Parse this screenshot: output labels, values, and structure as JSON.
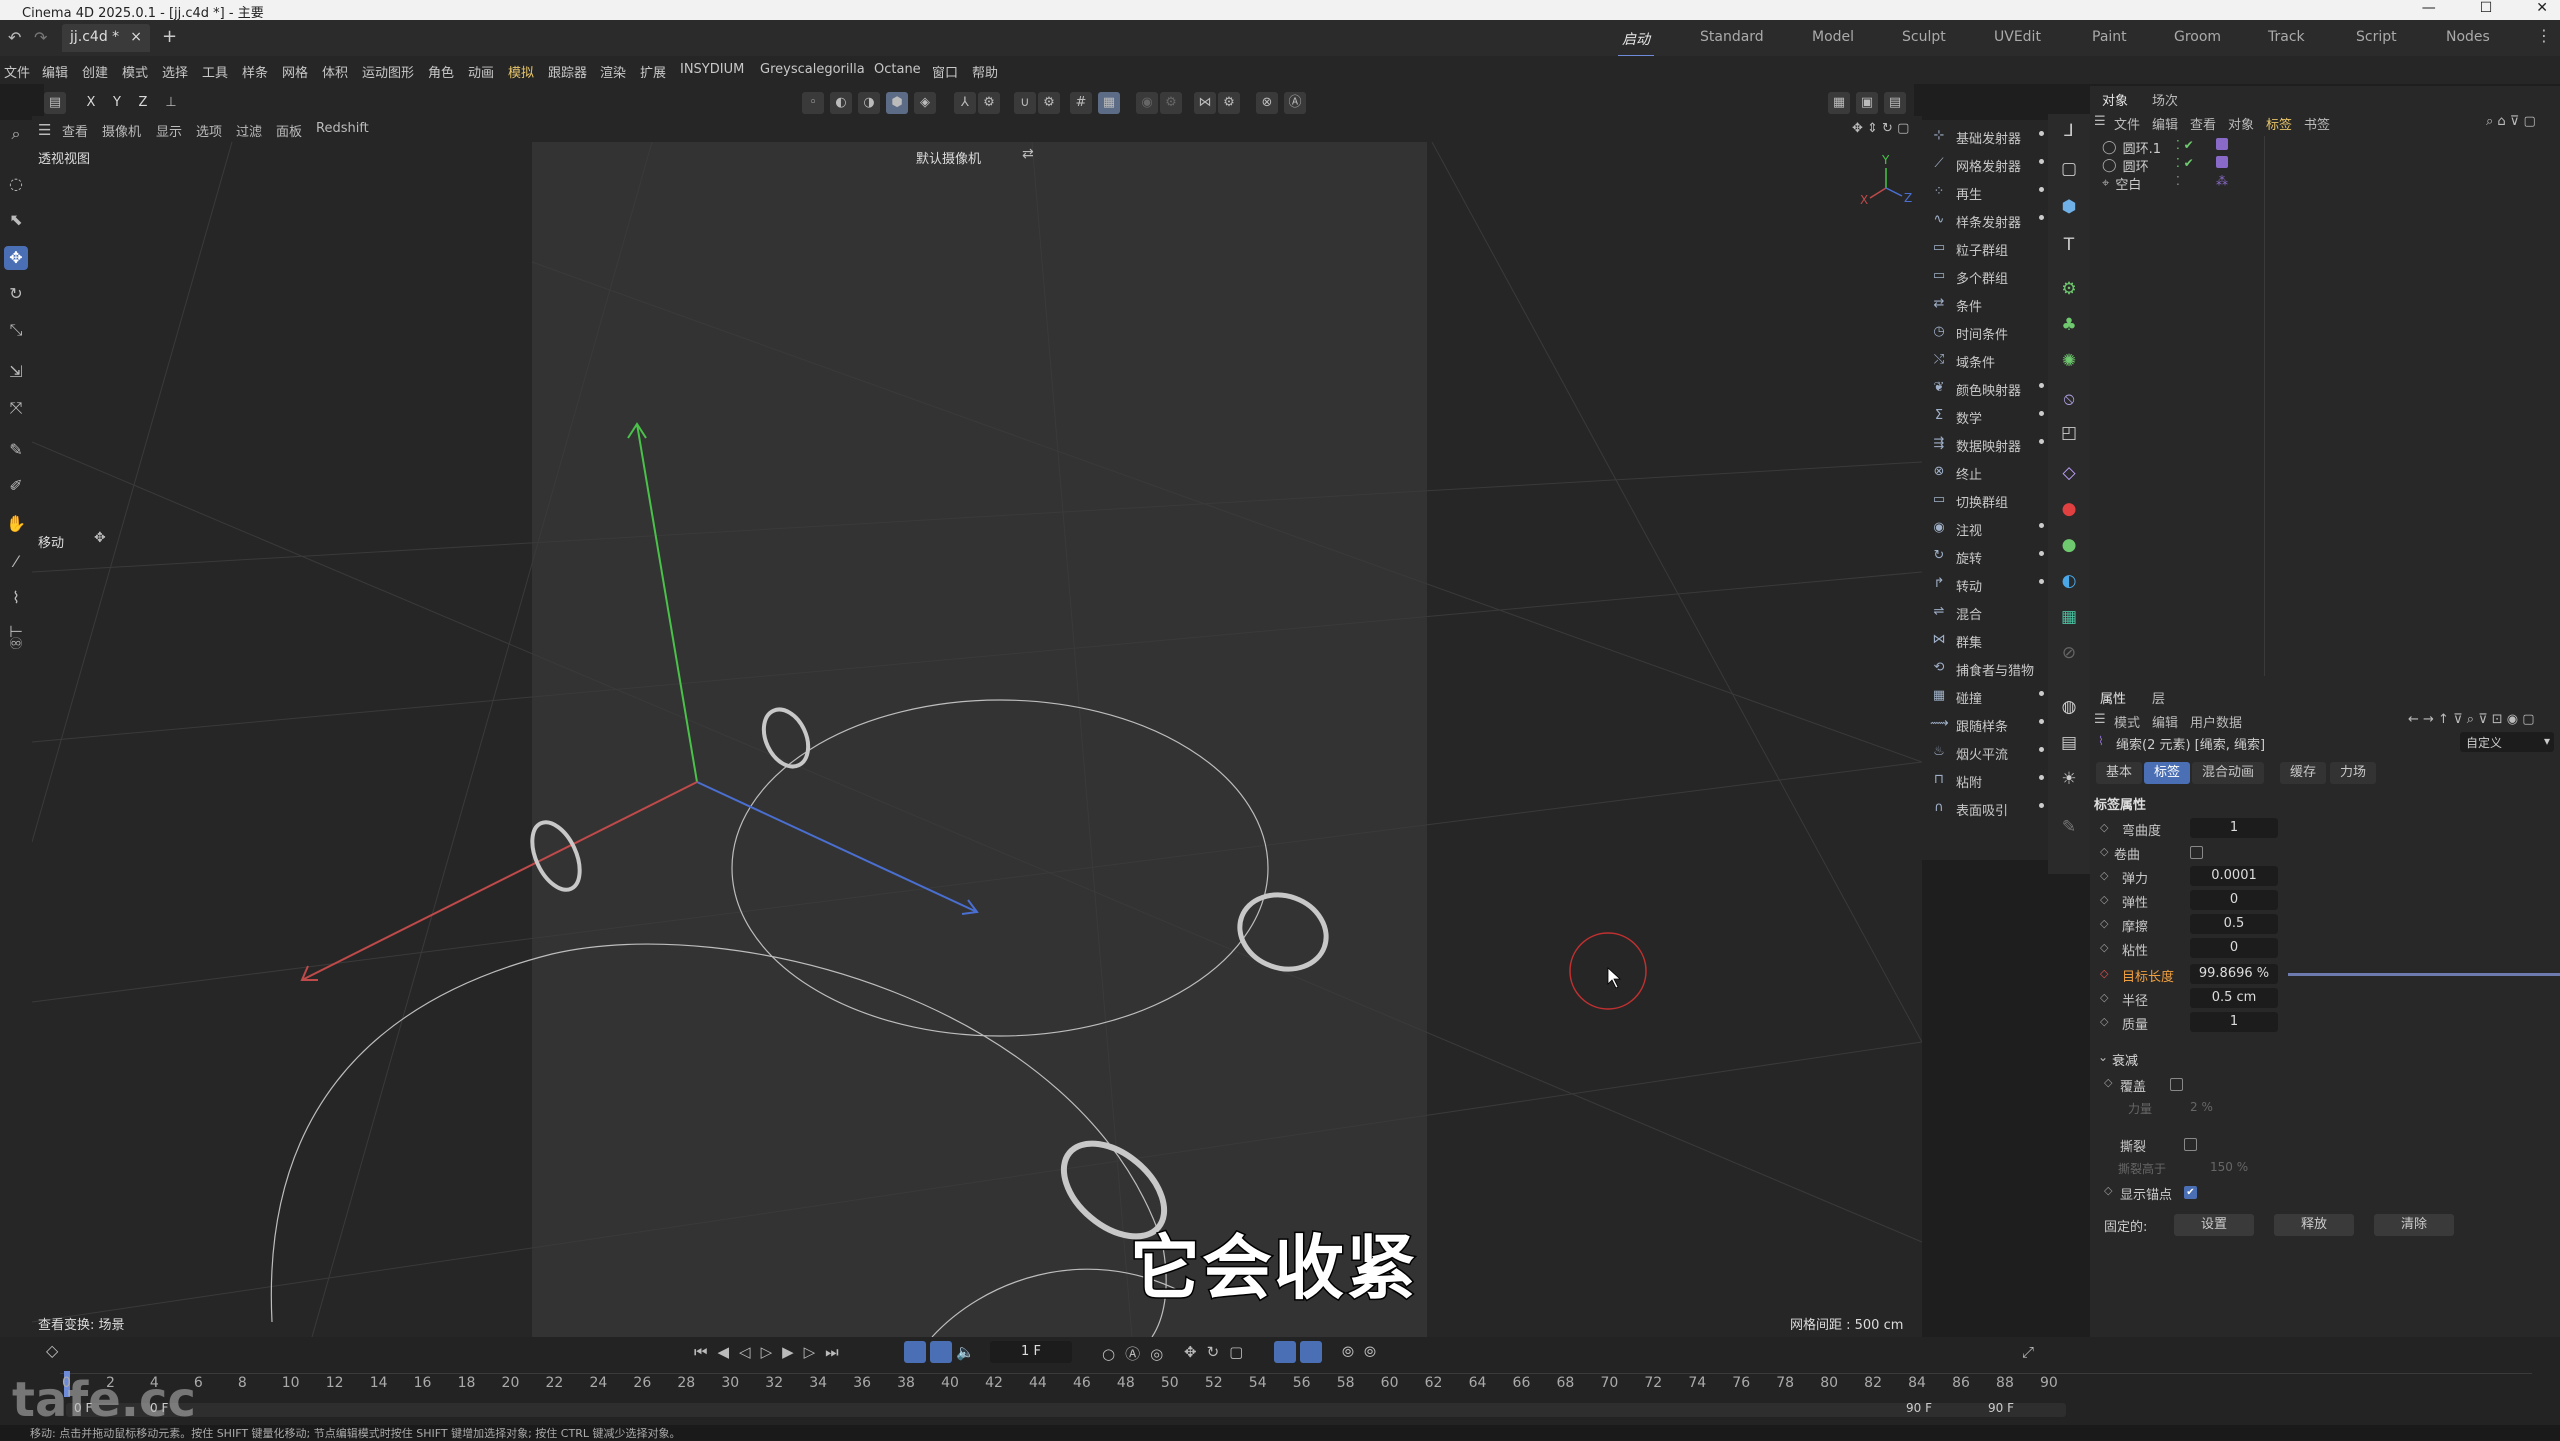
{
  "window": {
    "title": "Cinema 4D 2025.0.1 - [jj.c4d *] - 主要",
    "controls": [
      "—",
      "☐",
      "✕"
    ]
  },
  "document_tab": {
    "label": "jj.c4d *",
    "close": "×",
    "add": "+"
  },
  "layouts": [
    "启动",
    "Standard",
    "Model",
    "Sculpt",
    "UVEdit",
    "Paint",
    "Groom",
    "Track",
    "Script",
    "Nodes"
  ],
  "menu": [
    "文件",
    "编辑",
    "创建",
    "模式",
    "选择",
    "工具",
    "样条",
    "网格",
    "体积",
    "运动图形",
    "角色",
    "动画",
    "模拟",
    "跟踪器",
    "渲染",
    "扩展",
    "INSYDIUM",
    "Greyscalegorilla",
    "Octane",
    "窗口",
    "帮助"
  ],
  "axis_lock": [
    "X",
    "Y",
    "Z"
  ],
  "viewport_menu": [
    "查看",
    "摄像机",
    "显示",
    "选项",
    "过滤",
    "面板",
    "Redshift"
  ],
  "viewport": {
    "name": "透视视图",
    "camera": "默认摄像机",
    "tool": "移动",
    "status_left": "查看变换: 场景",
    "grid_spacing": "网格间距 : 500 cm"
  },
  "fx_menu": [
    "基础发射器",
    "网格发射器",
    "再生",
    "样条发射器",
    "粒子群组",
    "多个群组",
    "条件",
    "时间条件",
    "域条件",
    "颜色映射器",
    "数学",
    "数据映射器",
    "终止",
    "切换群组",
    "注视",
    "旋转",
    "转动",
    "混合",
    "群集",
    "捕食者与猎物",
    "碰撞",
    "跟随样条",
    "烟火平流",
    "粘附",
    "表面吸引"
  ],
  "object_panel": {
    "tabs": [
      "对象",
      "场次"
    ],
    "menu": [
      "文件",
      "编辑",
      "查看",
      "对象",
      "标签",
      "书签"
    ],
    "objects": [
      "圆环.1",
      "圆环",
      "空白"
    ]
  },
  "attributes": {
    "tabs": [
      "属性",
      "层"
    ],
    "menu": [
      "模式",
      "编辑",
      "用户数据"
    ],
    "object_label": "绳索(2 元素) [绳索, 绳索]",
    "dropdown": "自定义",
    "sub_tabs": [
      "基本",
      "标签",
      "混合动画",
      "缓存",
      "力场"
    ],
    "section": "标签属性",
    "rows": [
      {
        "label": "弯曲度",
        "value": "1"
      },
      {
        "label": "卷曲",
        "value": ""
      },
      {
        "label": "弹力",
        "value": "0.0001"
      },
      {
        "label": "弹性",
        "value": "0"
      },
      {
        "label": "摩擦",
        "value": "0.5"
      },
      {
        "label": "粘性",
        "value": "0"
      },
      {
        "label": "目标长度",
        "value": "99.8696 %"
      },
      {
        "label": "半径",
        "value": "0.5 cm"
      },
      {
        "label": "质量",
        "value": "1"
      }
    ],
    "damping_section": "衰减",
    "override_label": "覆盖",
    "strength_label": "力量",
    "strength_value": "2 %",
    "tear_label": "撕裂",
    "tear_at_label": "撕裂高于",
    "tear_at_value": "150 %",
    "show_anchor_label": "显示锚点",
    "fixed_label": "固定的:",
    "buttons": [
      "设置",
      "释放",
      "清除"
    ]
  },
  "timeline": {
    "ticks": [
      "0",
      "2",
      "4",
      "6",
      "8",
      "10",
      "12",
      "14",
      "16",
      "18",
      "20",
      "22",
      "24",
      "26",
      "28",
      "30",
      "32",
      "34",
      "36",
      "38",
      "40",
      "42",
      "44",
      "46",
      "48",
      "50",
      "52",
      "54",
      "56",
      "58",
      "60",
      "62",
      "64",
      "66",
      "68",
      "70",
      "72",
      "74",
      "76",
      "78",
      "80",
      "82",
      "84",
      "86",
      "88",
      "90"
    ],
    "current_frame": "1 F",
    "start": "0 F",
    "start2": "0 F",
    "end": "90 F",
    "end2": "90 F"
  },
  "status_bar": "移动: 点击并拖动鼠标移动元素。按住 SHIFT 键量化移动; 节点编辑模式时按住 SHIFT 键增加选择对象; 按住 CTRL 键减少选择对象。",
  "subtitle": "它会收紧",
  "watermark": "tafe.cc"
}
